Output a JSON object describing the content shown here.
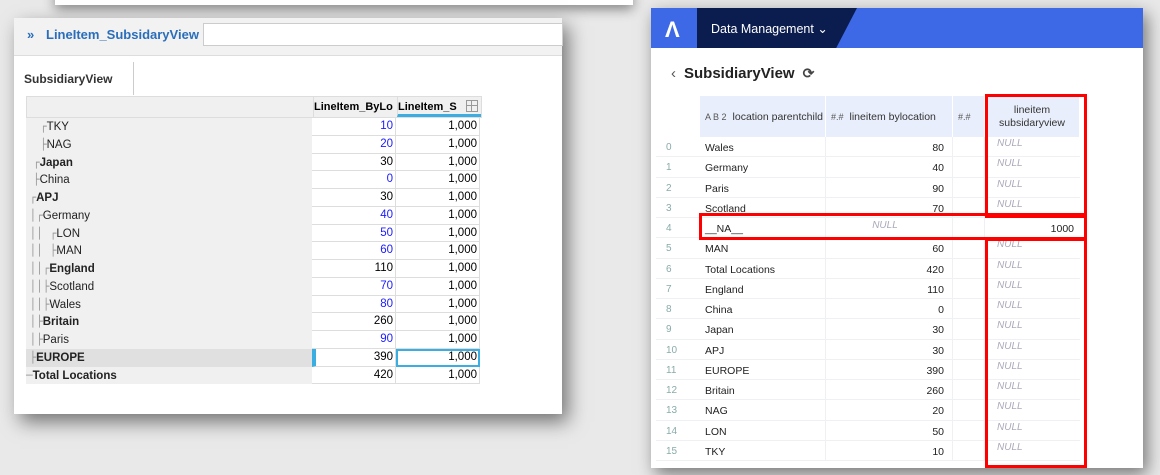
{
  "left": {
    "header_title": "LineItem_SubsidaryView",
    "tab": "SubsidiaryView",
    "columns": [
      "LineItem_ByLo",
      "LineItem_S"
    ],
    "rows": [
      {
        "tree": "    ┌",
        "label": "TKY",
        "bold": false,
        "a": "10",
        "b": "1,000",
        "blue": true
      },
      {
        "tree": "    ├",
        "label": "NAG",
        "bold": false,
        "a": "20",
        "b": "1,000",
        "blue": true
      },
      {
        "tree": "  ┌",
        "label": "Japan",
        "bold": true,
        "a": "30",
        "b": "1,000",
        "blue": false
      },
      {
        "tree": "  ├",
        "label": "China",
        "bold": false,
        "a": "0",
        "b": "1,000",
        "blue": true
      },
      {
        "tree": " ┌",
        "label": "APJ",
        "bold": true,
        "a": "30",
        "b": "1,000",
        "blue": false
      },
      {
        "tree": " │┌",
        "label": "Germany",
        "bold": false,
        "a": "40",
        "b": "1,000",
        "blue": true
      },
      {
        "tree": " ││  ┌",
        "label": "LON",
        "bold": false,
        "a": "50",
        "b": "1,000",
        "blue": true
      },
      {
        "tree": " ││  ├",
        "label": "MAN",
        "bold": false,
        "a": "60",
        "b": "1,000",
        "blue": true
      },
      {
        "tree": " ││┌",
        "label": "England",
        "bold": true,
        "a": "110",
        "b": "1,000",
        "blue": false
      },
      {
        "tree": " ││├",
        "label": "Scotland",
        "bold": false,
        "a": "70",
        "b": "1,000",
        "blue": true
      },
      {
        "tree": " ││├",
        "label": "Wales",
        "bold": false,
        "a": "80",
        "b": "1,000",
        "blue": true
      },
      {
        "tree": " │├",
        "label": "Britain",
        "bold": true,
        "a": "260",
        "b": "1,000",
        "blue": false
      },
      {
        "tree": " │├",
        "label": "Paris",
        "bold": false,
        "a": "90",
        "b": "1,000",
        "blue": true
      },
      {
        "tree": " ├",
        "label": "EUROPE",
        "bold": true,
        "a": "390",
        "b": "1,000",
        "blue": false,
        "sel": true
      },
      {
        "tree": "─",
        "label": "Total Locations",
        "bold": true,
        "a": "420",
        "b": "1,000",
        "blue": false
      }
    ]
  },
  "right": {
    "nav": "Data Management",
    "title": "SubsidiaryView",
    "columns": [
      "location parentchild",
      "lineitem bylocation",
      "lineitem subsidaryview"
    ],
    "type_text": "A B 2",
    "type_num": "#.#",
    "rows": [
      [
        "0",
        "Wales",
        "80",
        "NULL"
      ],
      [
        "1",
        "Germany",
        "40",
        "NULL"
      ],
      [
        "2",
        "Paris",
        "90",
        "NULL"
      ],
      [
        "3",
        "Scotland",
        "70",
        "NULL"
      ],
      [
        "4",
        "__NA__",
        "NULL",
        "1000"
      ],
      [
        "5",
        "MAN",
        "60",
        "NULL"
      ],
      [
        "6",
        "Total Locations",
        "420",
        "NULL"
      ],
      [
        "7",
        "England",
        "110",
        "NULL"
      ],
      [
        "8",
        "China",
        "0",
        "NULL"
      ],
      [
        "9",
        "Japan",
        "30",
        "NULL"
      ],
      [
        "10",
        "APJ",
        "30",
        "NULL"
      ],
      [
        "11",
        "EUROPE",
        "390",
        "NULL"
      ],
      [
        "12",
        "Britain",
        "260",
        "NULL"
      ],
      [
        "13",
        "NAG",
        "20",
        "NULL"
      ],
      [
        "14",
        "LON",
        "50",
        "NULL"
      ],
      [
        "15",
        "TKY",
        "10",
        "NULL"
      ]
    ],
    "highlight_color": "#ff0000"
  }
}
